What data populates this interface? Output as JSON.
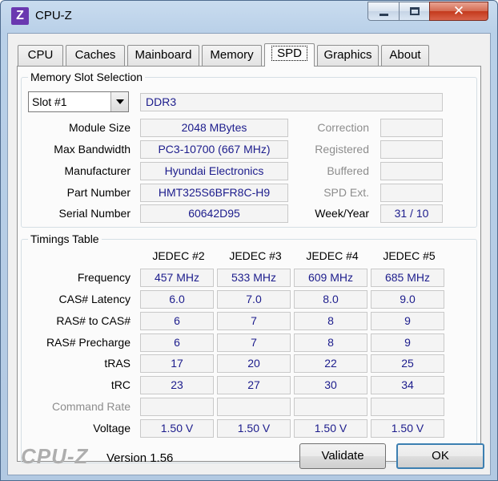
{
  "window": {
    "title": "CPU-Z",
    "icon_letter": "Z",
    "close_glyph": "✕"
  },
  "tabs": [
    "CPU",
    "Caches",
    "Mainboard",
    "Memory",
    "SPD",
    "Graphics",
    "About"
  ],
  "active_tab": "SPD",
  "slot": {
    "group_title": "Memory Slot Selection",
    "selected": "Slot #1",
    "type": "DDR3",
    "labels": {
      "module_size": "Module Size",
      "max_bandwidth": "Max Bandwidth",
      "manufacturer": "Manufacturer",
      "part_number": "Part Number",
      "serial_number": "Serial Number",
      "correction": "Correction",
      "registered": "Registered",
      "buffered": "Buffered",
      "spd_ext": "SPD Ext.",
      "week_year": "Week/Year"
    },
    "values": {
      "module_size": "2048 MBytes",
      "max_bandwidth": "PC3-10700 (667 MHz)",
      "manufacturer": "Hyundai Electronics",
      "part_number": "HMT325S6BFR8C-H9",
      "serial_number": "60642D95",
      "correction": "",
      "registered": "",
      "buffered": "",
      "spd_ext": "",
      "week_year": "31 / 10"
    }
  },
  "timings": {
    "group_title": "Timings Table",
    "columns": [
      "JEDEC #2",
      "JEDEC #3",
      "JEDEC #4",
      "JEDEC #5"
    ],
    "rows": [
      {
        "label": "Frequency",
        "values": [
          "457 MHz",
          "533 MHz",
          "609 MHz",
          "685 MHz"
        ]
      },
      {
        "label": "CAS# Latency",
        "values": [
          "6.0",
          "7.0",
          "8.0",
          "9.0"
        ]
      },
      {
        "label": "RAS# to CAS#",
        "values": [
          "6",
          "7",
          "8",
          "9"
        ]
      },
      {
        "label": "RAS# Precharge",
        "values": [
          "6",
          "7",
          "8",
          "9"
        ]
      },
      {
        "label": "tRAS",
        "values": [
          "17",
          "20",
          "22",
          "25"
        ]
      },
      {
        "label": "tRC",
        "values": [
          "23",
          "27",
          "30",
          "34"
        ]
      },
      {
        "label": "Command Rate",
        "values": [
          "",
          "",
          "",
          ""
        ]
      },
      {
        "label": "Voltage",
        "values": [
          "1.50 V",
          "1.50 V",
          "1.50 V",
          "1.50 V"
        ]
      }
    ]
  },
  "footer": {
    "brand": "CPU-Z",
    "version": "Version 1.56",
    "validate_label": "Validate",
    "ok_label": "OK"
  }
}
